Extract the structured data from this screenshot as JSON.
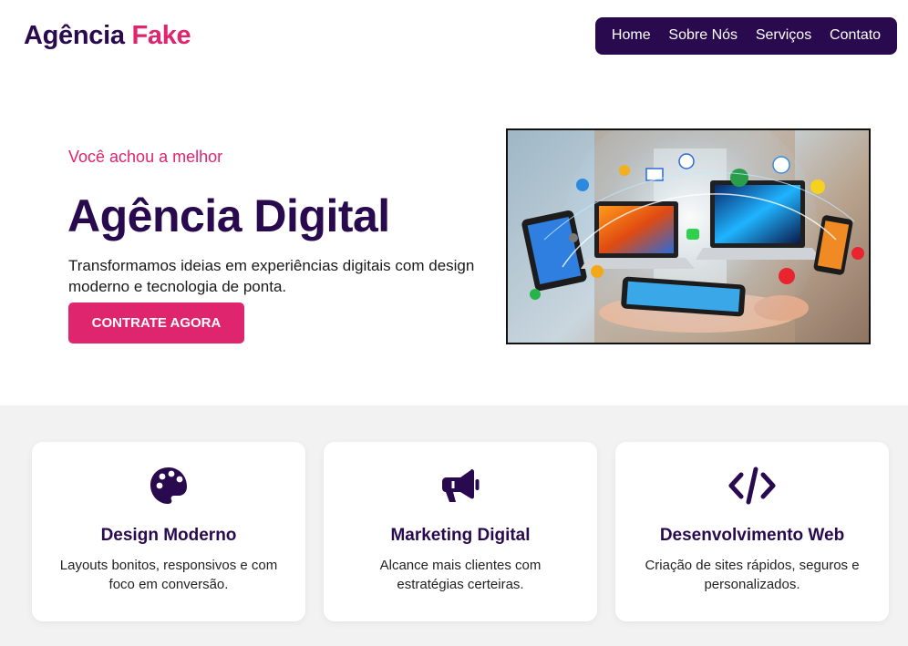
{
  "header": {
    "logo_main": "Agência",
    "logo_accent": "Fake",
    "nav": [
      "Home",
      "Sobre Nós",
      "Serviços",
      "Contato"
    ]
  },
  "hero": {
    "eyebrow": "Você achou a melhor",
    "title": "Agência Digital",
    "description": "Transformamos ideias em experiências digitais com design moderno e tecnologia de ponta.",
    "cta_label": "CONTRATE AGORA",
    "image_icon": "digital-devices-illustration"
  },
  "services": [
    {
      "icon": "palette-icon",
      "title": "Design Moderno",
      "text": "Layouts bonitos, responsivos e com foco em conversão."
    },
    {
      "icon": "megaphone-icon",
      "title": "Marketing Digital",
      "text": "Alcance mais clientes com estratégias certeiras."
    },
    {
      "icon": "code-icon",
      "title": "Desenvolvimento Web",
      "text": "Criação de sites rápidos, seguros e personalizados."
    }
  ],
  "colors": {
    "primary": "#2a0a4f",
    "accent": "#e0256f",
    "section_bg": "#f2f2f2"
  }
}
